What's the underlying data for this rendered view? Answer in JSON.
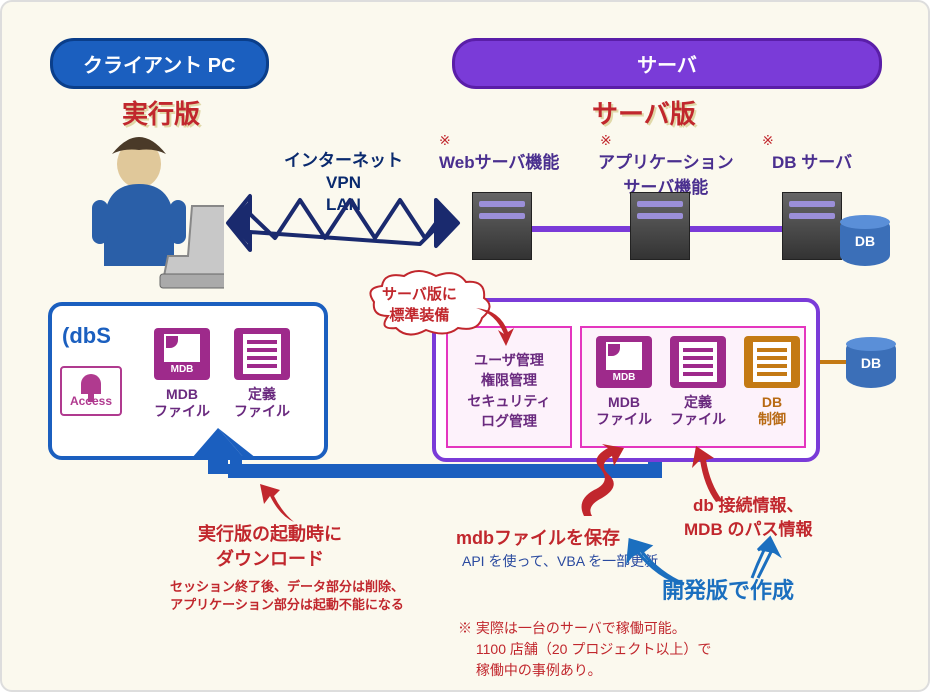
{
  "header": {
    "client_pc": "クライアント PC",
    "server": "サーバ"
  },
  "titles": {
    "exec_version": "実行版",
    "server_version": "サーバ版"
  },
  "network": {
    "lines": "インターネット\nVPN\nLAN"
  },
  "servers": {
    "web": "Webサーバ機能",
    "app": "アプリケーション\nサーバ機能",
    "db": "DB サーバ",
    "asterisk": "※",
    "db_label": "DB"
  },
  "client_panel": {
    "dbs": "dbS",
    "access": "Access",
    "mdb_tag": "MDB",
    "mdb_caption": "MDB\nファイル",
    "def_caption": "定義\nファイル"
  },
  "server_panel": {
    "std_equip": "サーバ版に\n標準装備",
    "mgmt": "ユーザ管理\n権限管理\nセキュリティ\nログ管理",
    "mdb_tag": "MDB",
    "mdb_caption": "MDB\nファイル",
    "def_caption": "定義\nファイル",
    "db_ctrl": "DB\n制御"
  },
  "annotations": {
    "exec_download": "実行版の起動時に\nダウンロード",
    "exec_note": "セッション終了後、データ部分は削除、\nアプリケーション部分は起動不能になる",
    "save_mdb": "mdbファイルを保存",
    "api_note": "API を使って、VBA を一部更新",
    "db_conn": "db 接続情報、\nMDB のパス情報",
    "dev_create": "開発版で作成"
  },
  "footnote": "※ 実際は一台のサーバで稼働可能。\n　 1100 店舗（20 プロジェクト以上）で\n　 稼働中の事例あり。"
}
